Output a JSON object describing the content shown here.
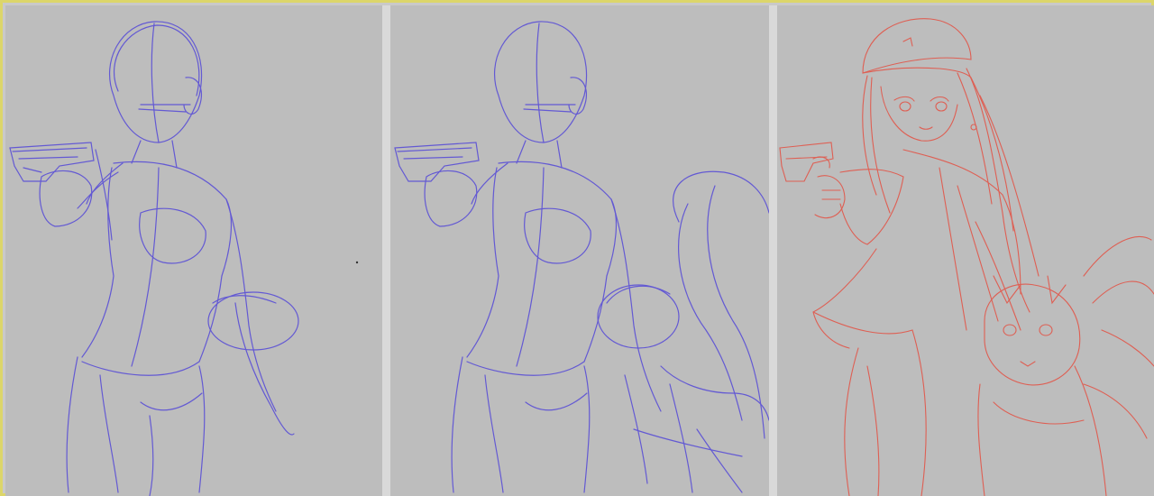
{
  "panels": [
    {
      "stage": "stage-1",
      "ink": "#5a4fd6",
      "content": "figure-sketch-with-pistol"
    },
    {
      "stage": "stage-2",
      "ink": "#5a4fd6",
      "content": "figure-sketch-with-pistol-and-cat"
    },
    {
      "stage": "stage-3",
      "ink": "#e05a4e",
      "content": "line-art-girl-with-cap-pistol-and-cat"
    }
  ],
  "colors": {
    "frame": "#dcd66a",
    "canvas": "#bdbdbd",
    "divider": "#d9d9d9"
  }
}
